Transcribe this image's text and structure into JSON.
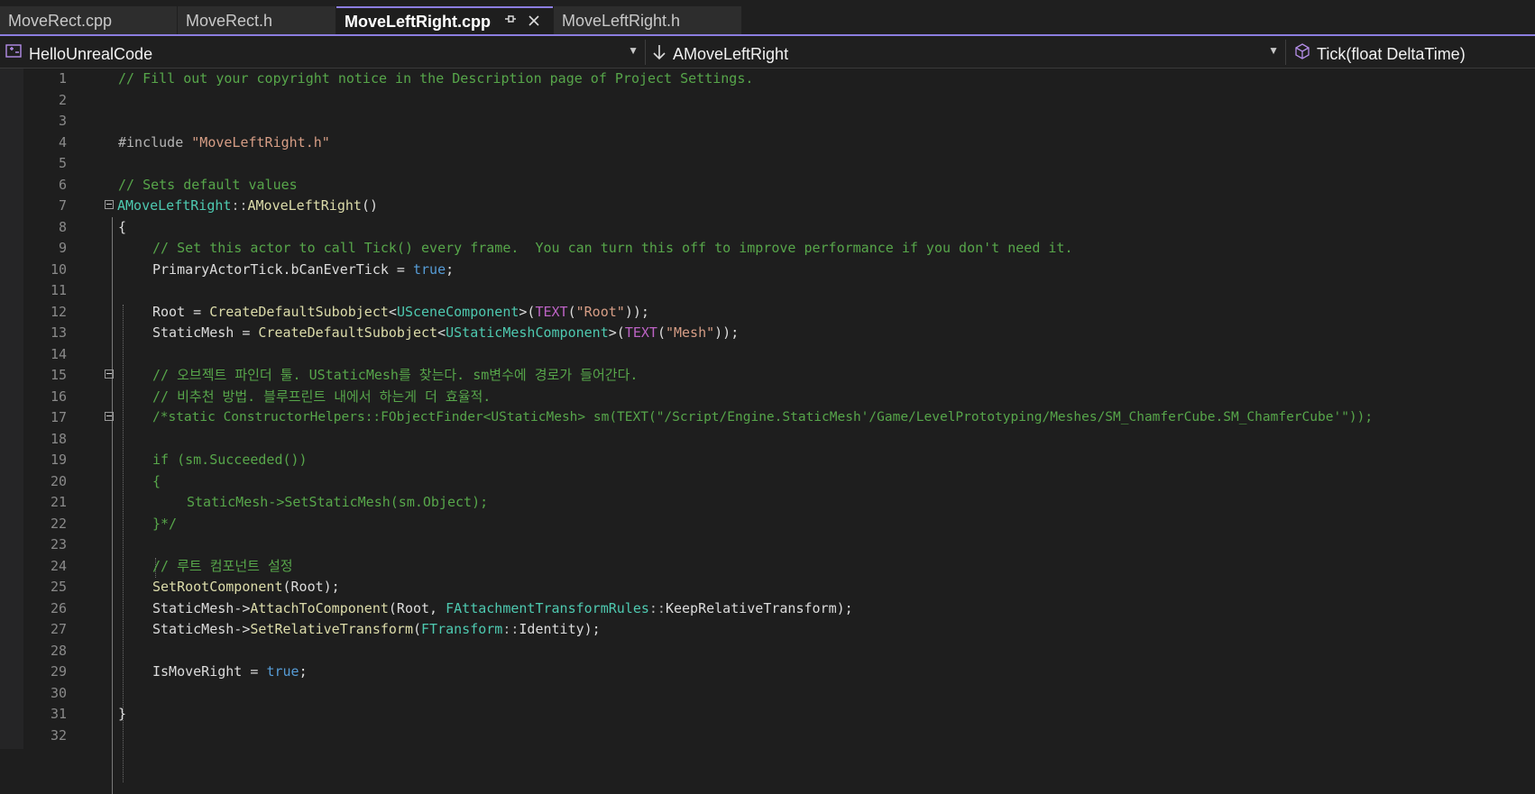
{
  "tabs": [
    {
      "label": "MoveRect.cpp"
    },
    {
      "label": "MoveRect.h"
    },
    {
      "label": "MoveLeftRight.cpp"
    },
    {
      "label": "MoveLeftRight.h"
    }
  ],
  "tab_icons": {
    "pin": "pin-icon",
    "close": "close-icon"
  },
  "navbar": {
    "project": "HelloUnrealCode",
    "scope": "AMoveLeftRight",
    "member": "Tick(float DeltaTime)"
  },
  "colors": {
    "accent": "#8c7ee0",
    "comment": "#57a64a",
    "keyword": "#569cd6",
    "type": "#4ec9b0",
    "function": "#dcdcaa",
    "string": "#d69d85",
    "macro": "#bd63c5"
  },
  "code": {
    "line_numbers": [
      "1",
      "2",
      "3",
      "4",
      "5",
      "6",
      "7",
      "8",
      "9",
      "10",
      "11",
      "12",
      "13",
      "14",
      "15",
      "16",
      "17",
      "18",
      "19",
      "20",
      "21",
      "22",
      "23",
      "24",
      "25",
      "26",
      "27",
      "28",
      "29",
      "30",
      "31",
      "32"
    ],
    "l1": "// Fill out your copyright notice in the Description page of Project Settings.",
    "l4a": "#include ",
    "l4b": "\"MoveLeftRight.h\"",
    "l6": "// Sets default values",
    "l7a": "AMoveLeftRight",
    "l7b": "::",
    "l7c": "AMoveLeftRight",
    "l7d": "()",
    "l8": "{",
    "l9": "// Set this actor to call Tick() every frame.  You can turn this off to improve performance if you don't need it.",
    "l10a": "PrimaryActorTick.bCanEverTick = ",
    "l10b": "true",
    "l10c": ";",
    "l12a": "Root = ",
    "l12b": "CreateDefaultSubobject",
    "l12c": "<",
    "l12d": "USceneComponent",
    "l12e": ">(",
    "l12f": "TEXT",
    "l12g": "(",
    "l12h": "\"Root\"",
    "l12i": "));",
    "l13a": "StaticMesh = ",
    "l13b": "CreateDefaultSubobject",
    "l13c": "<",
    "l13d": "UStaticMeshComponent",
    "l13e": ">(",
    "l13f": "TEXT",
    "l13g": "(",
    "l13h": "\"Mesh\"",
    "l13i": "));",
    "l15": "// 오브젝트 파인더 툴. UStaticMesh를 찾는다. sm변수에 경로가 들어간다.",
    "l16": "// 비추천 방법. 블루프린트 내에서 하는게 더 효율적.",
    "l17": "/*static ConstructorHelpers::FObjectFinder<UStaticMesh> sm(TEXT(\"/Script/Engine.StaticMesh'/Game/LevelPrototyping/Meshes/SM_ChamferCube.SM_ChamferCube'\"));",
    "l19": "if (sm.Succeeded())",
    "l20": "{",
    "l21": "StaticMesh->SetStaticMesh(sm.Object);",
    "l22": "}*/",
    "l24": "// 루트 컴포넌트 설정",
    "l25a": "SetRootComponent",
    "l25b": "(Root);",
    "l26a": "StaticMesh->",
    "l26b": "AttachToComponent",
    "l26c": "(Root, ",
    "l26d": "FAttachmentTransformRules",
    "l26e": "::",
    "l26f": "KeepRelativeTransform",
    "l26g": ");",
    "l27a": "StaticMesh->",
    "l27b": "SetRelativeTransform",
    "l27c": "(",
    "l27d": "FTransform",
    "l27e": "::",
    "l27f": "Identity",
    "l27g": ");",
    "l29a": "IsMoveRight = ",
    "l29b": "true",
    "l29c": ";",
    "l31": "}"
  }
}
